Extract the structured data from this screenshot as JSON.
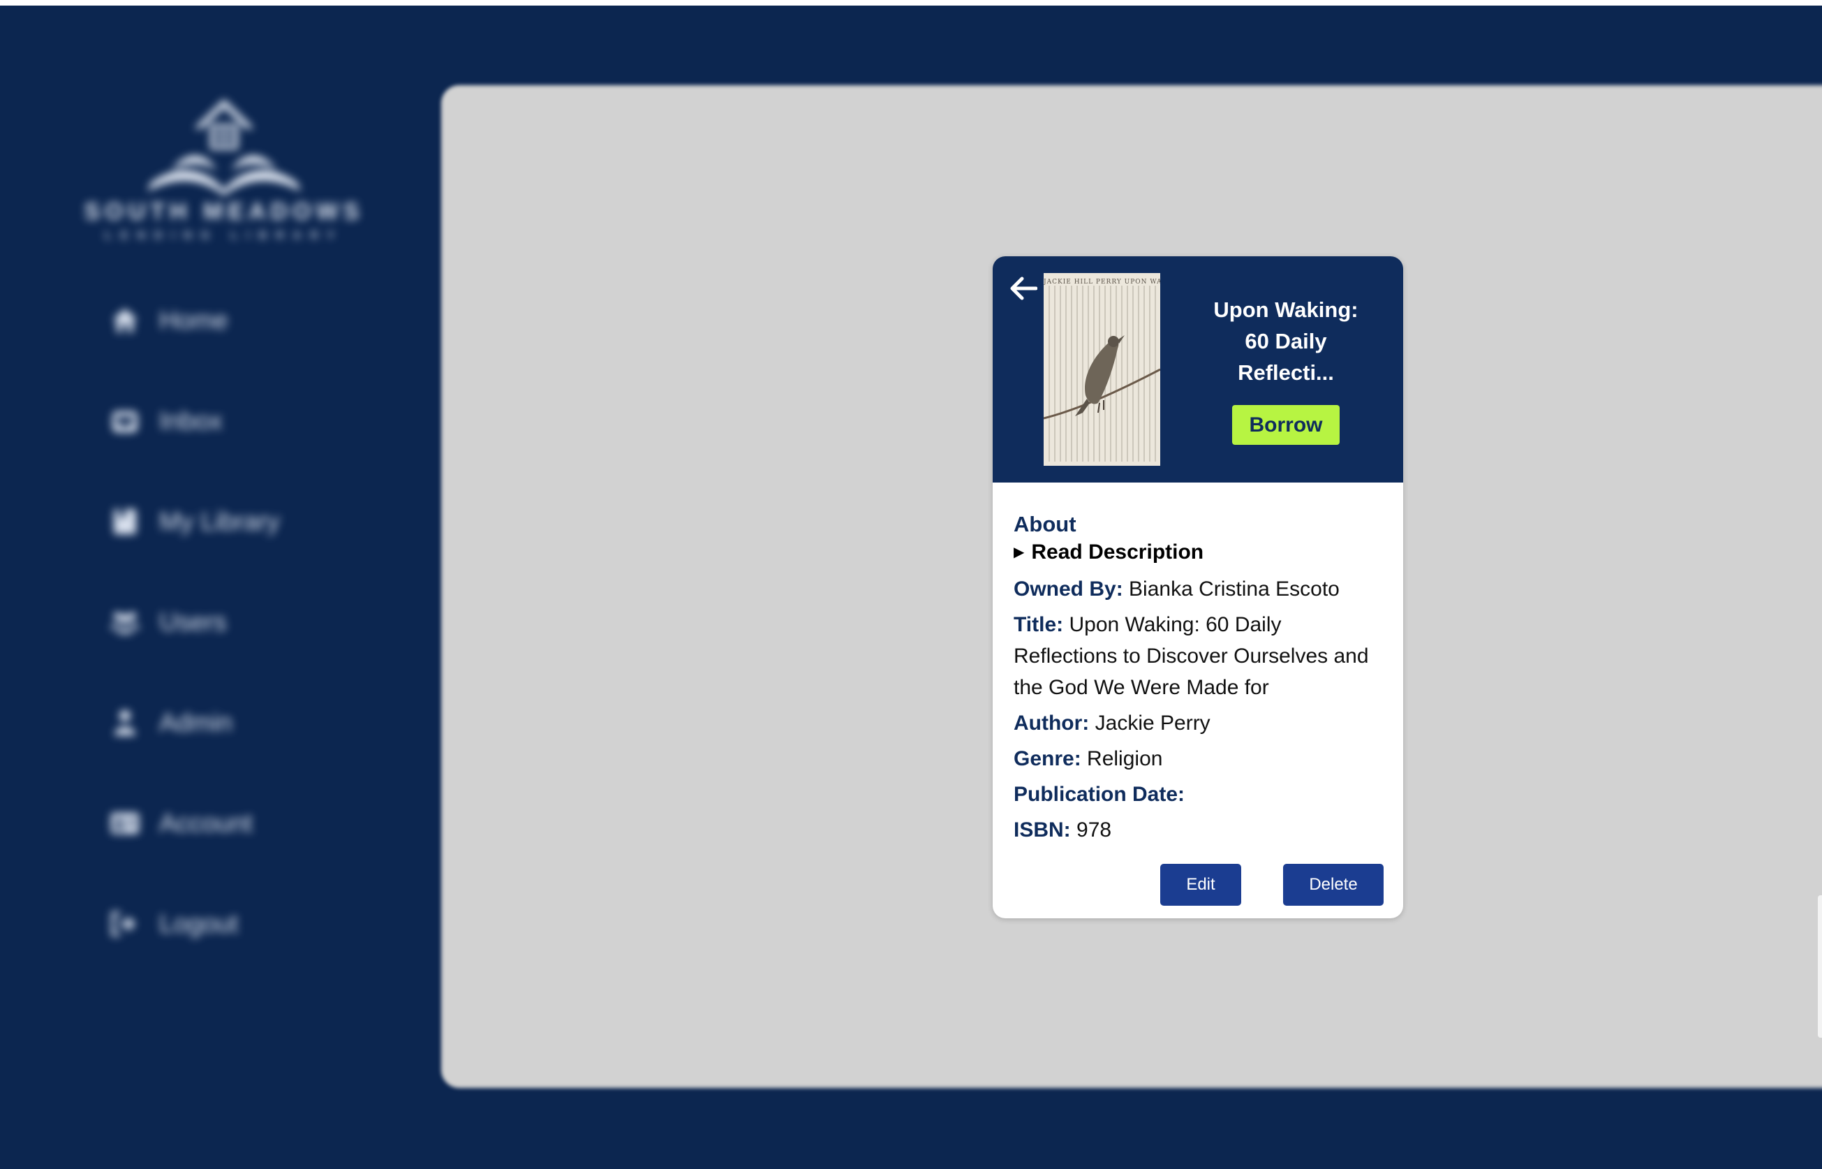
{
  "sidebar": {
    "logo": {
      "title": "SOUTH MEADOWS",
      "subtitle": "LENDING LIBRARY"
    },
    "items": [
      {
        "label": "Home",
        "icon": "home-icon"
      },
      {
        "label": "Inbox",
        "icon": "inbox-icon"
      },
      {
        "label": "My Library",
        "icon": "book-icon"
      },
      {
        "label": "Users",
        "icon": "users-icon"
      },
      {
        "label": "Admin",
        "icon": "person-icon"
      },
      {
        "label": "Account",
        "icon": "id-card-icon"
      },
      {
        "label": "Logout",
        "icon": "logout-icon"
      }
    ]
  },
  "book": {
    "header_title": "Upon Waking: 60 Daily Reflecti...",
    "cover_title": "JACKIE HILL PERRY UPON WAKING",
    "borrow_label": "Borrow",
    "about_label": "About",
    "description_toggle": "Read Description",
    "fields": {
      "owned_by": {
        "label": "Owned By:",
        "value": "Bianka Cristina Escoto"
      },
      "title": {
        "label": "Title:",
        "value": "Upon Waking: 60 Daily Reflections to Discover Ourselves and the God We Were Made for"
      },
      "author": {
        "label": "Author:",
        "value": "Jackie Perry"
      },
      "genre": {
        "label": "Genre:",
        "value": "Religion"
      },
      "publication_date": {
        "label": "Publication Date:",
        "value": ""
      },
      "isbn": {
        "label": "ISBN:",
        "value": "978"
      }
    },
    "edit_label": "Edit",
    "delete_label": "Delete"
  },
  "colors": {
    "navy": "#0c2650",
    "card_header": "#0f2c5c",
    "accent_green": "#b7f442",
    "button_blue": "#1b3d91",
    "panel_gray": "#d2d2d2"
  }
}
